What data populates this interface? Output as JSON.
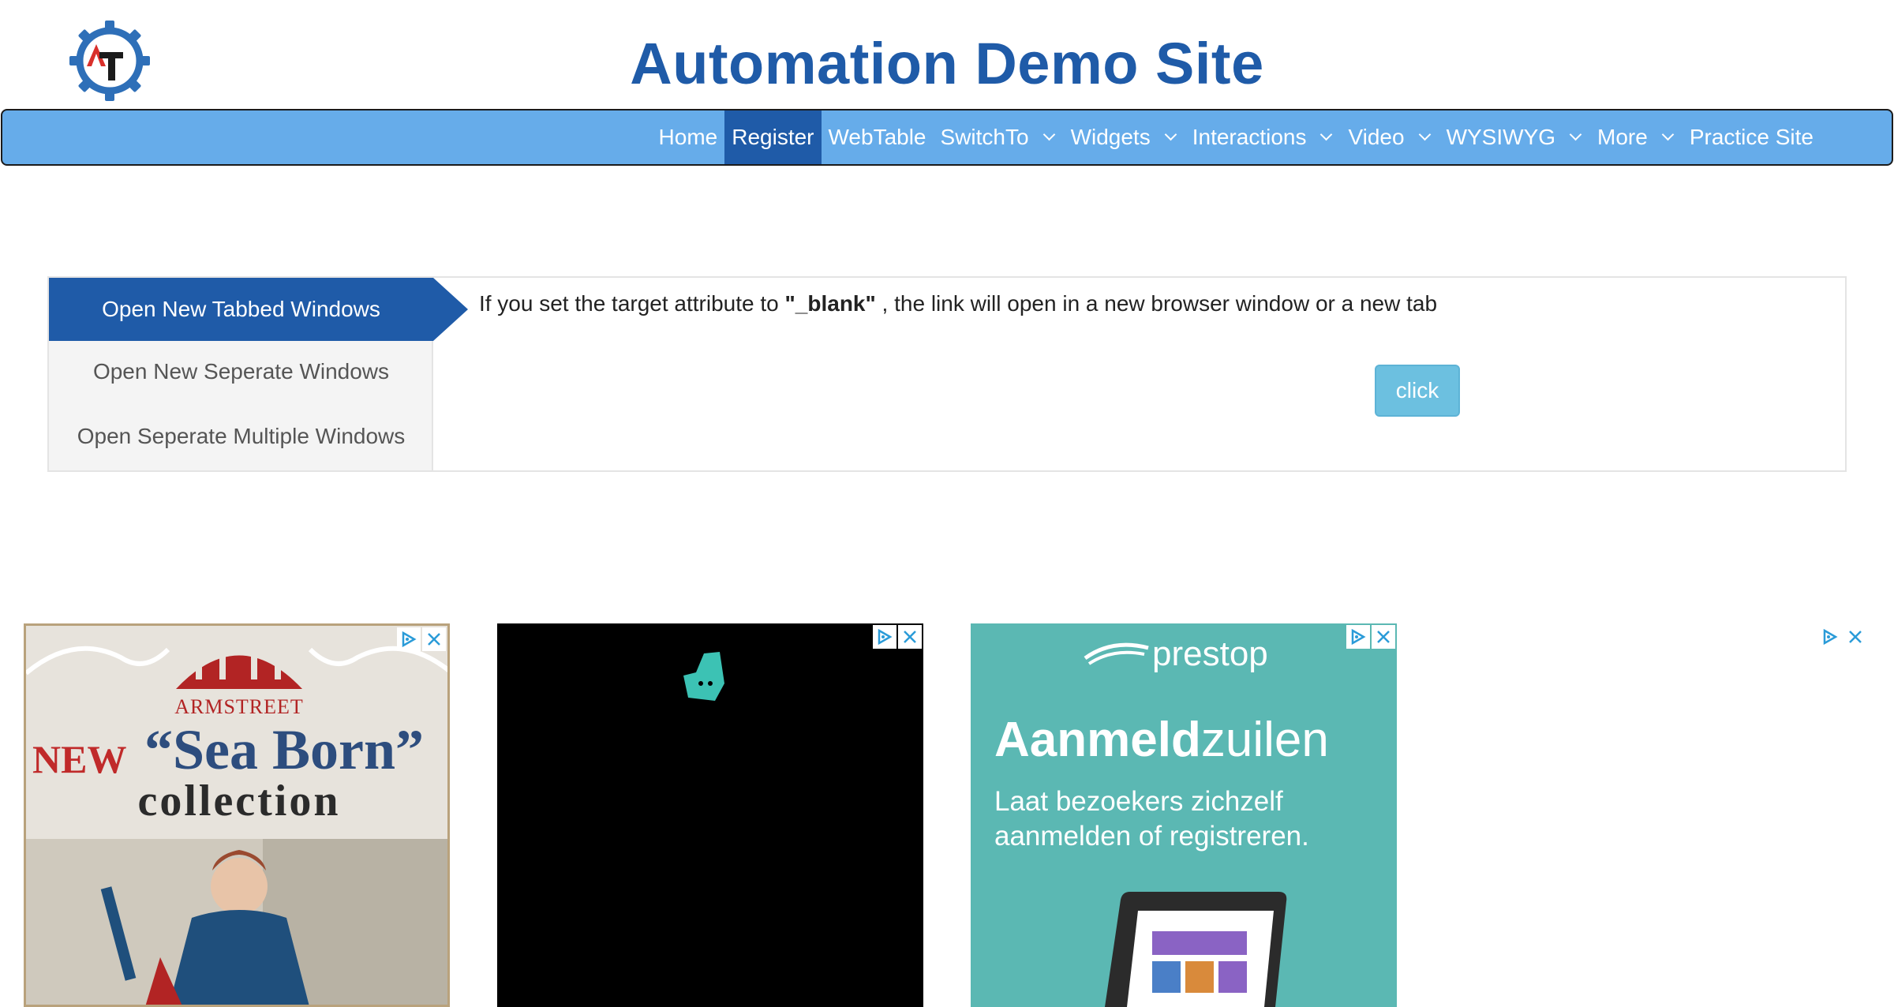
{
  "header": {
    "title": "Automation Demo Site"
  },
  "nav": {
    "items": [
      {
        "label": "Home"
      },
      {
        "label": "Register"
      },
      {
        "label": "WebTable"
      },
      {
        "label": "SwitchTo"
      },
      {
        "label": "Widgets"
      },
      {
        "label": "Interactions"
      },
      {
        "label": "Video"
      },
      {
        "label": "WYSIWYG"
      },
      {
        "label": "More"
      },
      {
        "label": "Practice Site"
      }
    ],
    "active": "Register"
  },
  "tabs": {
    "items": [
      {
        "label": "Open New Tabbed Windows"
      },
      {
        "label": "Open New Seperate Windows"
      },
      {
        "label": "Open Seperate Multiple Windows"
      }
    ],
    "active_index": 0
  },
  "content": {
    "text_before": "If you set the target attribute to ",
    "text_bold": "\"_blank\"",
    "text_after": " , the link will open in a new browser window or a new tab",
    "button_label": "click"
  },
  "ads": {
    "ad1": {
      "brand": "ARMSTREET",
      "new": "NEW",
      "headline": "“Sea Born”",
      "subline": "collection"
    },
    "ad3": {
      "brand": "prestop",
      "headline_bold": "Aanmeld",
      "headline_rest": "zuilen",
      "sub": "Laat bezoekers zichzelf aanmelden of registreren."
    }
  },
  "colors": {
    "brand_blue": "#1f5ba8",
    "nav_bg": "#66acea",
    "button_bg": "#6cc0e0"
  }
}
